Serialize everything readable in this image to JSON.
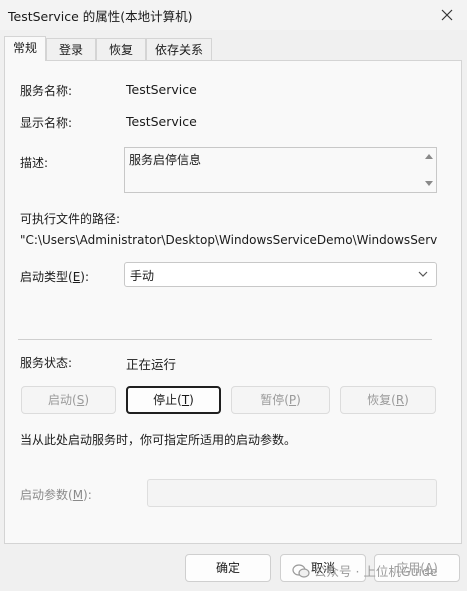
{
  "window": {
    "title": "TestService 的属性(本地计算机)"
  },
  "tabs": [
    {
      "label": "常规",
      "active": true
    },
    {
      "label": "登录",
      "active": false
    },
    {
      "label": "恢复",
      "active": false
    },
    {
      "label": "依存关系",
      "active": false
    }
  ],
  "general": {
    "service_name_label": "服务名称:",
    "service_name_value": "TestService",
    "display_name_label": "显示名称:",
    "display_name_value": "TestService",
    "description_label": "描述:",
    "description_value": "服务启停信息",
    "exe_path_label": "可执行文件的路径:",
    "exe_path_value": "\"C:\\Users\\Administrator\\Desktop\\WindowsServiceDemo\\WindowsServic",
    "startup_type_label_pre": "启动类型(",
    "startup_type_label_key": "E",
    "startup_type_label_post": "):",
    "startup_type_value": "手动",
    "status_label": "服务状态:",
    "status_value": "正在运行",
    "buttons": {
      "start": {
        "pre": "启动(",
        "key": "S",
        "post": ")"
      },
      "stop": {
        "pre": "停止(",
        "key": "T",
        "post": ")"
      },
      "pause": {
        "pre": "暂停(",
        "key": "P",
        "post": ")"
      },
      "resume": {
        "pre": "恢复(",
        "key": "R",
        "post": ")"
      }
    },
    "hint": "当从此处启动服务时，你可指定所适用的启动参数。",
    "param_label_pre": "启动参数(",
    "param_label_key": "M",
    "param_label_post": "):",
    "param_value": ""
  },
  "footer": {
    "ok": "确定",
    "cancel": "取消",
    "apply_pre": "应用(",
    "apply_key": "A",
    "apply_post": ")"
  },
  "watermark": {
    "text": "公众号 · 上位机Guide"
  }
}
